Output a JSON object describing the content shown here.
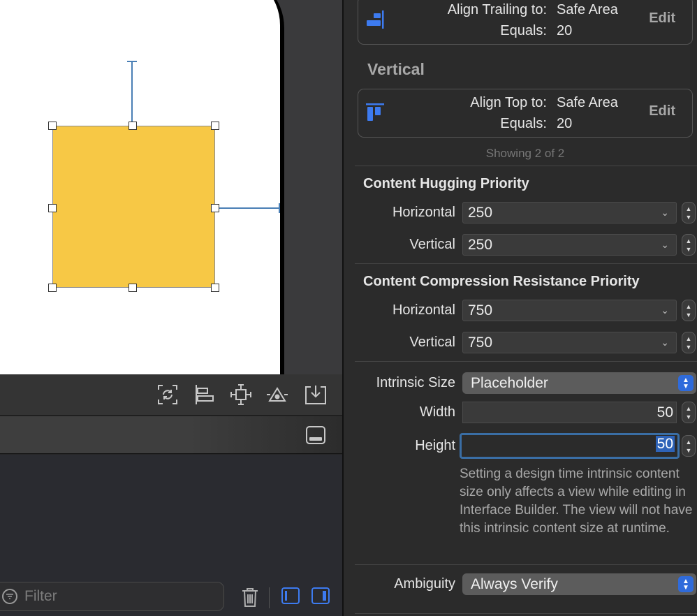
{
  "canvas": {
    "toolbar_icons": [
      "update-frames-icon",
      "align-icon",
      "add-constraints-icon",
      "resolve-issues-icon",
      "embed-in-icon"
    ]
  },
  "debug": {
    "toggle_icon": "hide-debug-area-icon"
  },
  "bottom_bar": {
    "filter_placeholder": "Filter",
    "icons": [
      "filter-icon",
      "trash-icon",
      "left-panel-toggle-icon",
      "right-panel-toggle-icon"
    ]
  },
  "constraints": {
    "trailing": {
      "label1": "Align Trailing to:",
      "value1": "Safe Area",
      "label2": "Equals:",
      "value2": "20",
      "edit": "Edit"
    },
    "vertical_header": "Vertical",
    "top": {
      "label1": "Align Top to:",
      "value1": "Safe Area",
      "label2": "Equals:",
      "value2": "20",
      "edit": "Edit"
    },
    "showing": "Showing 2 of 2"
  },
  "hugging": {
    "title": "Content Hugging Priority",
    "horizontal_label": "Horizontal",
    "horizontal_value": "250",
    "vertical_label": "Vertical",
    "vertical_value": "250"
  },
  "compression": {
    "title": "Content Compression Resistance Priority",
    "horizontal_label": "Horizontal",
    "horizontal_value": "750",
    "vertical_label": "Vertical",
    "vertical_value": "750"
  },
  "intrinsic": {
    "label": "Intrinsic Size",
    "value": "Placeholder",
    "width_label": "Width",
    "width_value": "50",
    "height_label": "Height",
    "height_value": "50",
    "help": "Setting a design time intrinsic content size only affects a view while editing in Interface Builder. The view will not have this intrinsic content size at runtime."
  },
  "ambiguity": {
    "label": "Ambiguity",
    "value": "Always Verify"
  },
  "colors": {
    "accent": "#2f6bdb",
    "view_fill": "#f7c845",
    "constraint": "#4a7fb5"
  }
}
